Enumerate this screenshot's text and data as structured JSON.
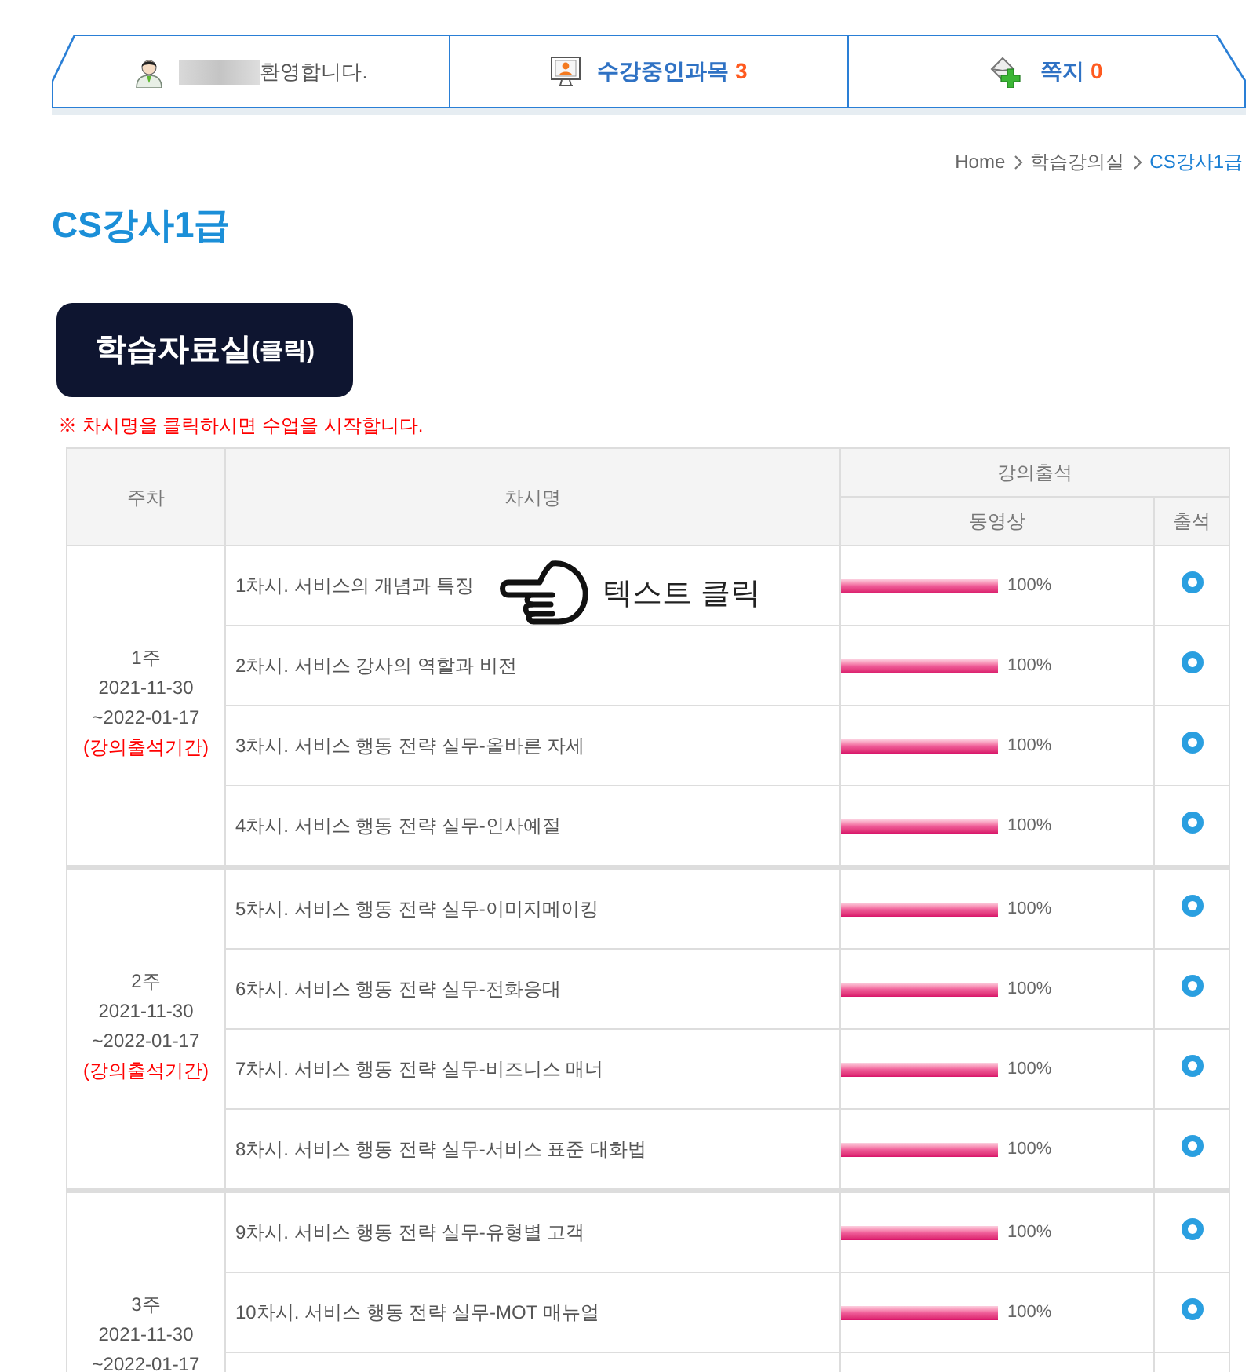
{
  "top_bar": {
    "welcome": {
      "text": "환영합니다."
    },
    "courses": {
      "label": "수강중인과목",
      "count": "3"
    },
    "messages": {
      "label": "쪽지",
      "count": "0"
    }
  },
  "breadcrumb": [
    {
      "label": "Home",
      "current": false
    },
    {
      "label": "학습강의실",
      "current": false
    },
    {
      "label": "CS강사1급",
      "current": true
    }
  ],
  "page_title": "CS강사1급",
  "materials_button": {
    "label": "학습자료실",
    "suffix": "(클릭)"
  },
  "notice": "※ 차시명을 클릭하시면 수업을 시작합니다.",
  "table": {
    "columns": {
      "week": "주차",
      "lesson": "차시명",
      "attendance_group": "강의출석",
      "video": "동영상",
      "attended": "출석"
    },
    "weeks": [
      {
        "week": "1주",
        "start": "2021-11-30",
        "end": "~2022-01-17",
        "period_note": "(강의출석기간)",
        "lessons": [
          {
            "title": "1차시. 서비스의 개념과 특징",
            "level": 1,
            "reading": "100%",
            "attended": true,
            "annotation": {
              "text": "텍스트 클릭"
            }
          },
          {
            "title": "2차시. 서비스 강사의 역할과 비전",
            "level": 1,
            "reading": "100%",
            "attended": true
          },
          {
            "title": "3차시. 서비스 행동 전략 실무-올바른 자세",
            "level": 1,
            "reading": "100%",
            "attended": true
          },
          {
            "title": "4차시. 서비스 행동 전략 실무-인사예절",
            "level": 1,
            "reading": "100%",
            "attended": true
          }
        ]
      },
      {
        "week": "2주",
        "start": "2021-11-30",
        "end": "~2022-01-17",
        "period_note": "(강의출석기간)",
        "lessons": [
          {
            "title": "5차시. 서비스 행동 전략 실무-이미지메이킹",
            "level": 1,
            "reading": "100%",
            "attended": true
          },
          {
            "title": "6차시. 서비스 행동 전략 실무-전화응대",
            "level": 1,
            "reading": "100%",
            "attended": true
          },
          {
            "title": "7차시. 서비스 행동 전략 실무-비즈니스 매너",
            "level": 1,
            "reading": "100%",
            "attended": true
          },
          {
            "title": "8차시. 서비스 행동 전략 실무-서비스 표준 대화법",
            "level": 1,
            "reading": "100%",
            "attended": true
          }
        ]
      },
      {
        "week": "3주",
        "start": "2021-11-30",
        "end": "~2022-01-17",
        "lessons": [
          {
            "title": "9차시. 서비스 행동 전략 실무-유형별 고객",
            "level": 1,
            "reading": "100%",
            "attended": true
          },
          {
            "title": "10차시. 서비스 행동 전략 실무-MOT 매뉴얼",
            "level": 1,
            "reading": "100%",
            "attended": true
          }
        ]
      }
    ]
  }
}
